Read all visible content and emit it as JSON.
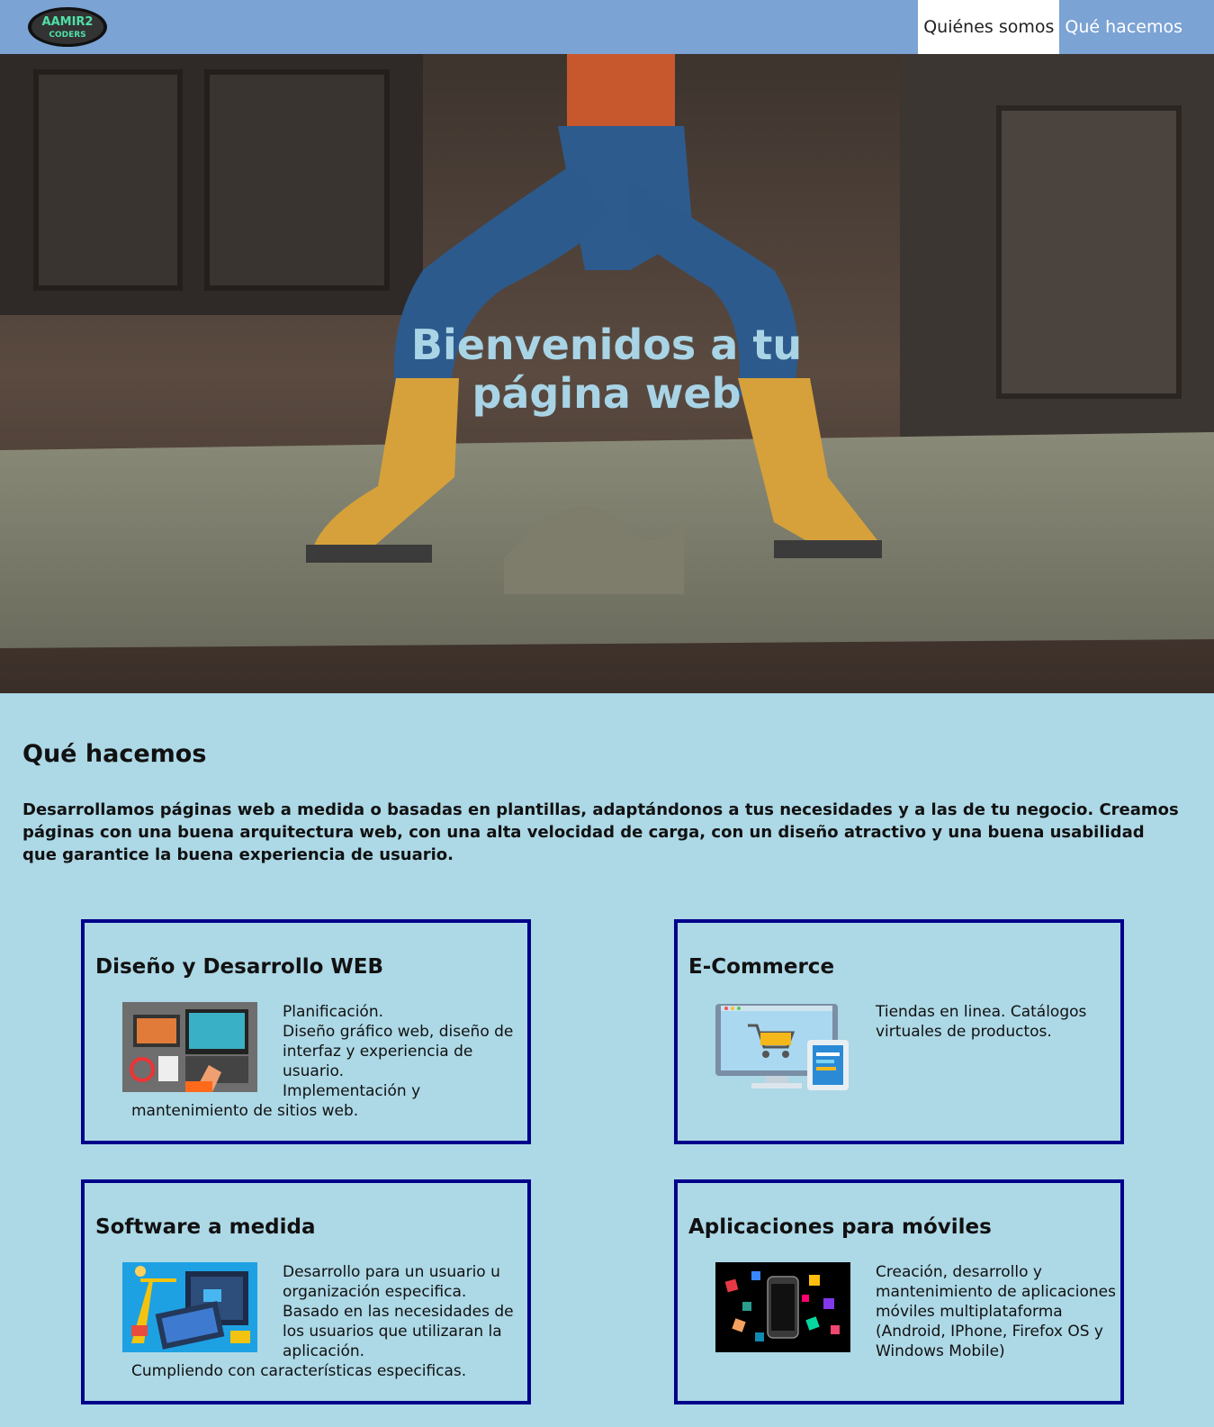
{
  "header": {
    "logo_text_top": "AAMIR2",
    "logo_text_bottom": "CODERS",
    "nav": [
      {
        "label": "Quiénes somos"
      },
      {
        "label": "Qué hacemos"
      }
    ]
  },
  "hero": {
    "title": "Bienvenidos a tu página web"
  },
  "main": {
    "title": "Qué hacemos",
    "intro": "Desarrollamos páginas web a medida o basadas en plantillas, adaptándonos a tus necesidades y a las de tu negocio. Creamos páginas con una buena arquitectura web, con una alta velocidad de carga, con un diseño atractivo y una buena usabilidad que garantice la buena experiencia de usuario.",
    "cards": [
      {
        "title": "Diseño y Desarrollo WEB",
        "lines": [
          "Planificación.",
          "Diseño gráfico web, diseño de interfaz y experiencia de usuario.",
          "Implementación y mantenimiento de sitios web."
        ],
        "image_icon": "web-design-illustration"
      },
      {
        "title": "E-Commerce",
        "lines": [
          "Tiendas en linea. Catálogos virtuales de productos."
        ],
        "image_icon": "ecommerce-illustration"
      },
      {
        "title": "Software a medida",
        "lines": [
          "Desarrollo para un usuario u organización especifica.",
          "Basado en las necesidades de los usuarios que utilizaran la aplicación.",
          "Cumpliendo con características especificas."
        ],
        "image_icon": "software-illustration"
      },
      {
        "title": "Aplicaciones para móviles",
        "lines": [
          "Creación, desarrollo y mantenimiento de aplicaciones móviles multiplataforma (Android, IPhone, Firefox OS y Windows Mobile)"
        ],
        "image_icon": "mobile-apps-illustration"
      }
    ]
  },
  "colors": {
    "header_bg": "#7ba3d4",
    "page_bg": "#add8e6",
    "card_border": "#00008b",
    "hero_title": "#a8d4e6"
  }
}
